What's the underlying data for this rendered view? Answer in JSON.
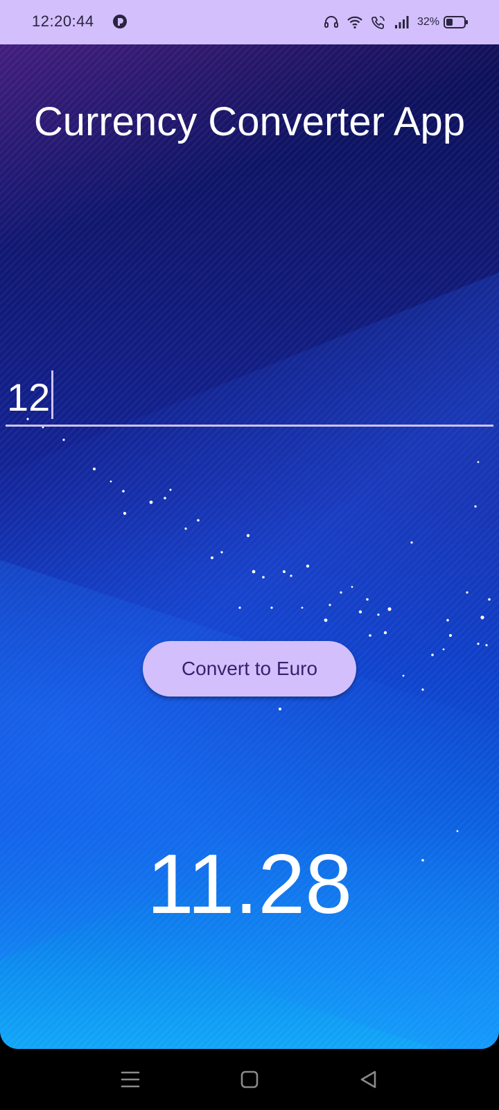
{
  "status_bar": {
    "time": "12:20:44",
    "battery_percent": "32%",
    "icons": [
      "app-notification-icon",
      "headset-icon",
      "wifi-icon",
      "wifi-calling-icon",
      "cellular-signal-icon",
      "battery-icon"
    ]
  },
  "app": {
    "title": "Currency Converter App",
    "amount_input": {
      "value": "12"
    },
    "convert_button_label": "Convert to Euro",
    "result": "11.28"
  },
  "nav_bar": {
    "icons": [
      "menu-icon",
      "home-icon",
      "back-icon"
    ]
  },
  "colors": {
    "status_bar_bg": "#d2bffb",
    "button_bg": "#d3bffb",
    "button_text": "#3a1f6e",
    "input_underline": "#cfc2f0"
  }
}
